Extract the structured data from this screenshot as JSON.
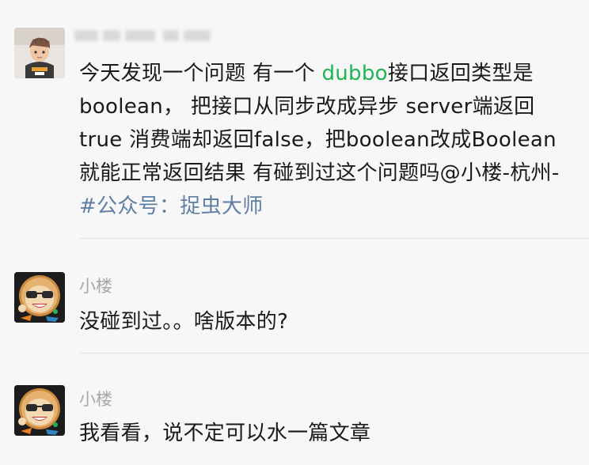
{
  "messages": [
    {
      "sender": "",
      "avatar_icon": "boy-avatar-icon",
      "text_parts": [
        {
          "text": "今天发现一个问题 有一个 ",
          "style": "normal"
        },
        {
          "text": "dubbo",
          "style": "green"
        },
        {
          "text": "接口返回类型是boolean， 把接口从同步改成异步 server端返回true 消费端却返回false，把boolean改成Boolean就能正常返回结果 有碰到过这个问题吗@小楼-杭州-",
          "style": "normal"
        },
        {
          "text": "#公众号：捉虫大师",
          "style": "blue"
        }
      ]
    },
    {
      "sender": "小楼",
      "avatar_icon": "cartoon-monkey-avatar-icon",
      "text": "没碰到过。。啥版本的?"
    },
    {
      "sender": "小楼",
      "avatar_icon": "cartoon-monkey-avatar-icon",
      "text": "我看看，说不定可以水一篇文章"
    }
  ],
  "colors": {
    "background": "#f7f7f7",
    "text": "#1a1a1a",
    "sender": "#a8a8a8",
    "link_green": "#1fb552",
    "link_blue": "#5f7ea4",
    "divider": "#e3e3e3"
  }
}
